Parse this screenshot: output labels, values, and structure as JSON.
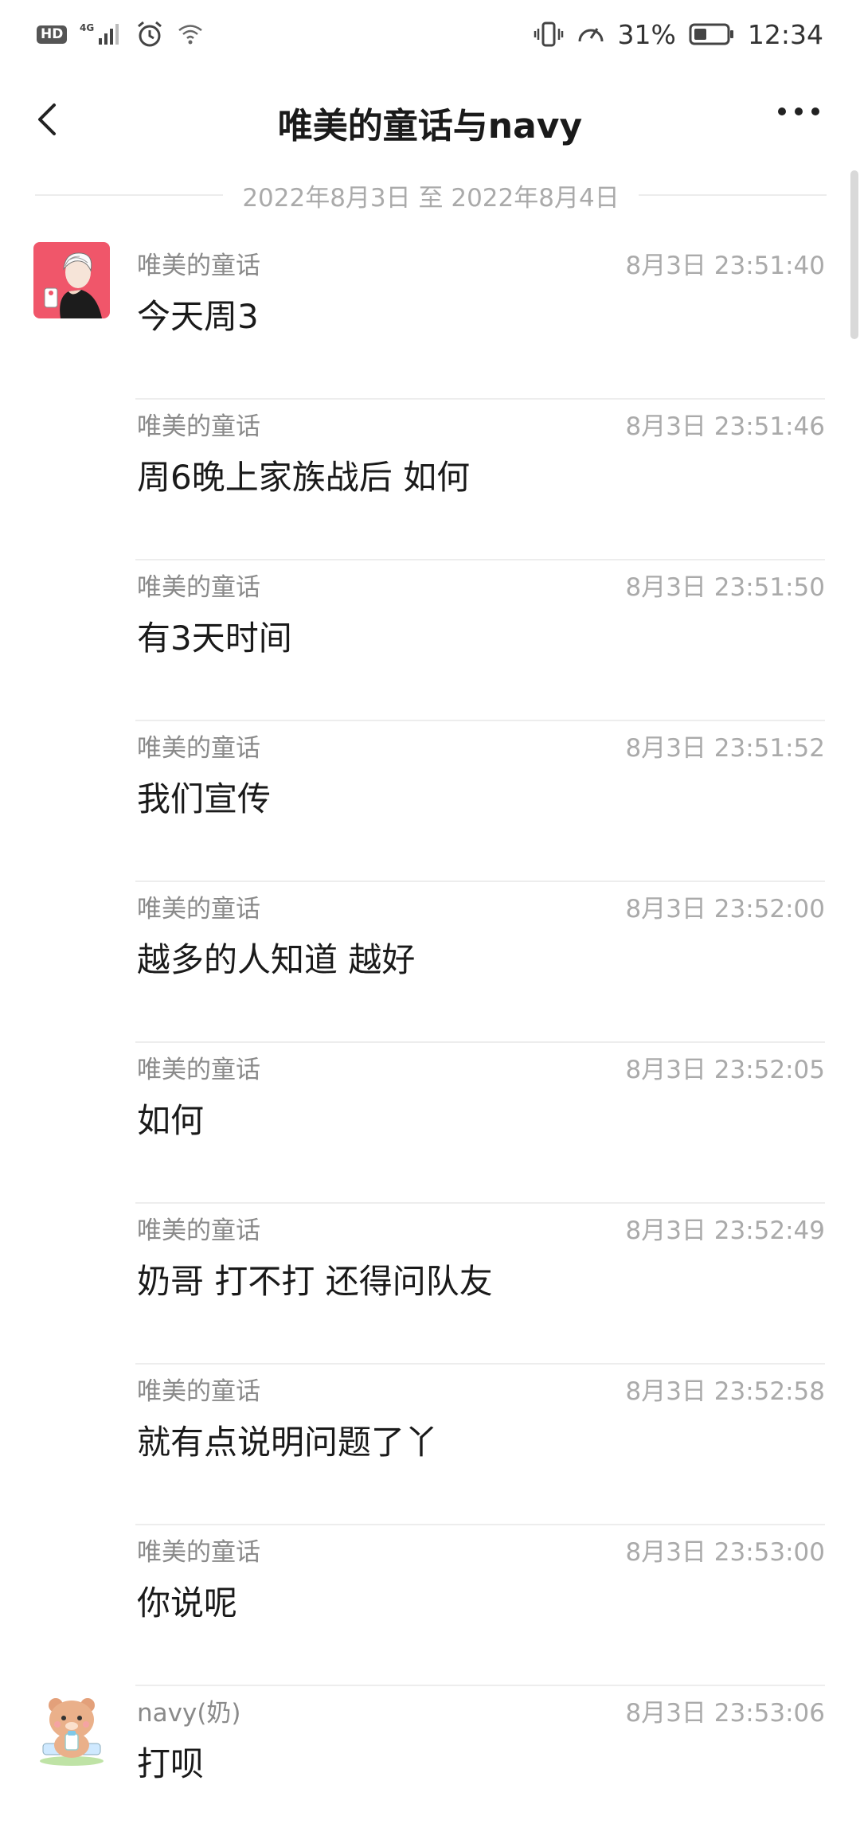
{
  "status_bar": {
    "left_badge": "HD",
    "network": "4G",
    "battery_percent": "31%",
    "time": "12:34"
  },
  "header": {
    "title": "唯美的童话与navy"
  },
  "date_range": {
    "text": "2022年8月3日 至 2022年8月4日"
  },
  "messages": [
    {
      "sender": "唯美的童话",
      "time": "8月3日 23:51:40",
      "content": "今天周3",
      "avatar": "woman-illustration-avatar"
    },
    {
      "sender": "唯美的童话",
      "time": "8月3日 23:51:46",
      "content": "周6晚上家族战后 如何"
    },
    {
      "sender": "唯美的童话",
      "time": "8月3日 23:51:50",
      "content": "有3天时间"
    },
    {
      "sender": "唯美的童话",
      "time": "8月3日 23:51:52",
      "content": "我们宣传"
    },
    {
      "sender": "唯美的童话",
      "time": "8月3日 23:52:00",
      "content": "越多的人知道 越好"
    },
    {
      "sender": "唯美的童话",
      "time": "8月3日 23:52:05",
      "content": "如何"
    },
    {
      "sender": "唯美的童话",
      "time": "8月3日 23:52:49",
      "content": "奶哥 打不打 还得问队友"
    },
    {
      "sender": "唯美的童话",
      "time": "8月3日 23:52:58",
      "content": "就有点说明问题了丫"
    },
    {
      "sender": "唯美的童话",
      "time": "8月3日 23:53:00",
      "content": "你说呢"
    },
    {
      "sender": "navy(奶)",
      "time": "8月3日 23:53:06",
      "content": "打呗",
      "avatar": "bear-cartoon-avatar"
    }
  ],
  "colors": {
    "avatar1_bg": "#f0566a",
    "avatar2_bg": "#ffffff",
    "divider": "#ededed"
  }
}
